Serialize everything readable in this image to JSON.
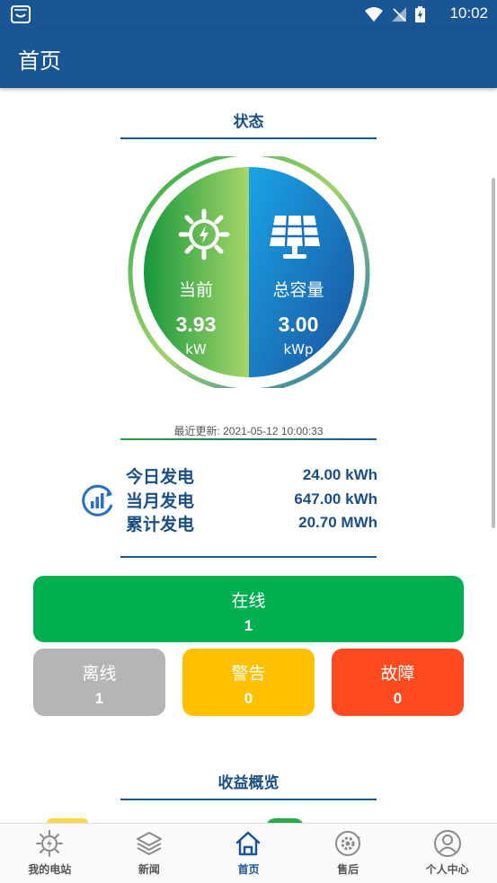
{
  "status_bar": {
    "time": "10:02"
  },
  "app_bar": {
    "title": "首页"
  },
  "status_section": {
    "title": "状态",
    "current": {
      "label": "当前",
      "value": "3.93",
      "unit": "kW"
    },
    "capacity": {
      "label": "总容量",
      "value": "3.00",
      "unit": "kWp"
    },
    "last_update": "最近更新: 2021-05-12 10:00:33"
  },
  "energy": {
    "icon": "energy-chart-icon",
    "rows": [
      {
        "label": "今日发电",
        "value": "24.00 kWh"
      },
      {
        "label": "当月发电",
        "value": "647.00 kWh"
      },
      {
        "label": "累计发电",
        "value": "20.70 MWh"
      }
    ]
  },
  "device_status": {
    "online": {
      "label": "在线",
      "count": "1",
      "color": "#00b050"
    },
    "offline": {
      "label": "离线",
      "count": "1",
      "color": "#b5b5b5"
    },
    "warning": {
      "label": "警告",
      "count": "0",
      "color": "#ffc000"
    },
    "fault": {
      "label": "故障",
      "count": "0",
      "color": "#ff4b1f"
    }
  },
  "revenue_section": {
    "title": "收益概览"
  },
  "bottom_nav": {
    "items": [
      {
        "label": "我的电站",
        "icon": "sun-icon",
        "active": false
      },
      {
        "label": "新闻",
        "icon": "layers-icon",
        "active": false
      },
      {
        "label": "首页",
        "icon": "home-icon",
        "active": true
      },
      {
        "label": "售后",
        "icon": "service-gear-icon",
        "active": false
      },
      {
        "label": "个人中心",
        "icon": "person-icon",
        "active": false
      }
    ]
  },
  "colors": {
    "brand": "#1a5594",
    "text_blue": "#1a4f86"
  }
}
